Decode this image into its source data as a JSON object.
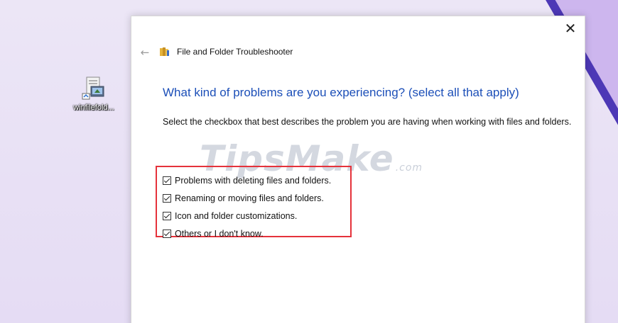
{
  "desktop": {
    "icon_label": "winfilefold...",
    "icon": "troubleshooter-file-icon"
  },
  "window": {
    "close_glyph": "✕",
    "back_glyph": "←",
    "title": "File and Folder Troubleshooter",
    "heading": "What kind of problems are you experiencing? (select all that apply)",
    "description": "Select the checkbox that best describes the problem you are having when working with files and folders.",
    "options": [
      {
        "label": "Problems with deleting files and folders.",
        "checked": true
      },
      {
        "label": "Renaming or moving files and folders.",
        "checked": true
      },
      {
        "label": "Icon and folder customizations.",
        "checked": true
      },
      {
        "label": "Others or I don't know.",
        "checked": true
      }
    ],
    "heading_color": "#1c4fb8",
    "highlight_color": "#e5323b"
  },
  "watermark": {
    "text": "TipsMake",
    "suffix": ".com"
  }
}
